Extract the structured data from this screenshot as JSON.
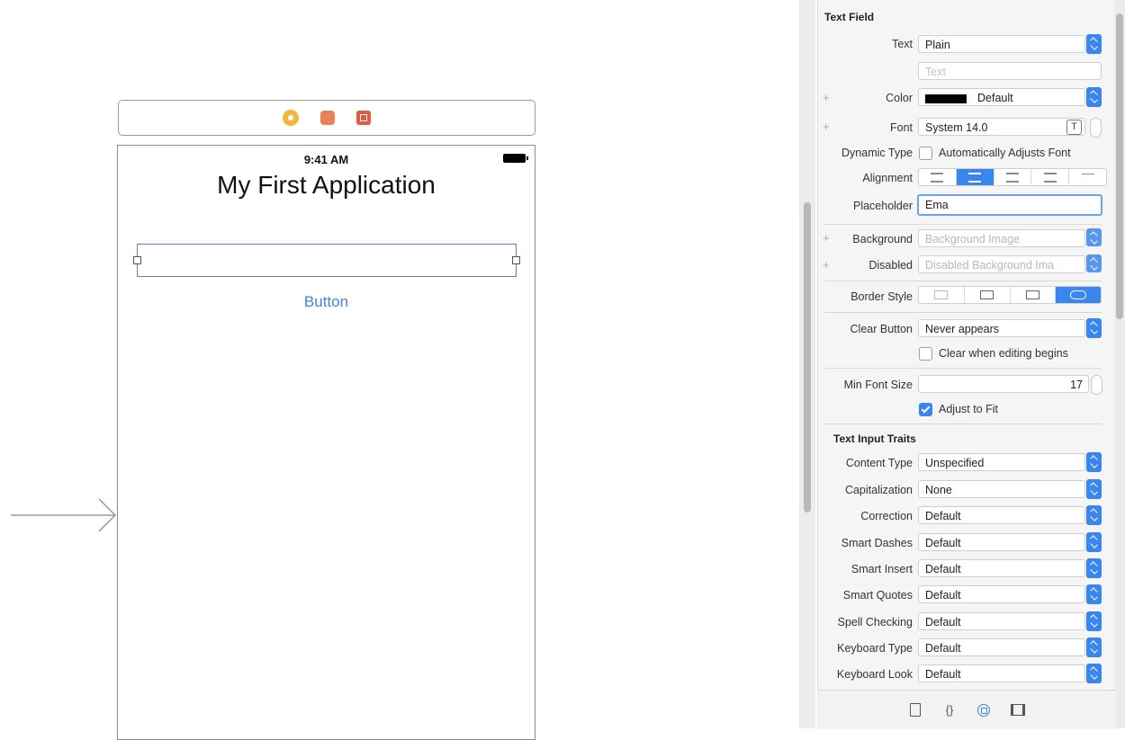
{
  "canvas": {
    "status_time": "9:41 AM",
    "app_title": "My First Application",
    "text_field_value": "",
    "button_label": "Button"
  },
  "inspector": {
    "section_title": "Text Field",
    "text_label": "Text",
    "text_type": "Plain",
    "text_placeholder": "Text",
    "color_label": "Color",
    "color_value": "Default",
    "font_label": "Font",
    "font_value": "System 14.0",
    "font_t_glyph": "T",
    "dynamic_type_label": "Dynamic Type",
    "dynamic_type_checkbox": "Automatically Adjusts Font",
    "alignment_label": "Alignment",
    "placeholder_label": "Placeholder",
    "placeholder_value": "Ema",
    "background_label": "Background",
    "background_value": "Background Image",
    "disabled_label": "Disabled",
    "disabled_value": "Disabled Background Ima",
    "border_style_label": "Border Style",
    "clear_button_label": "Clear Button",
    "clear_button_value": "Never appears",
    "clear_when_editing": "Clear when editing begins",
    "min_font_size_label": "Min Font Size",
    "min_font_size_value": "17",
    "adjust_to_fit": "Adjust to Fit",
    "traits_title": "Text Input Traits",
    "plus_glyph": "+",
    "traits": [
      {
        "label": "Content Type",
        "value": "Unspecified"
      },
      {
        "label": "Capitalization",
        "value": "None"
      },
      {
        "label": "Correction",
        "value": "Default"
      },
      {
        "label": "Smart Dashes",
        "value": "Default"
      },
      {
        "label": "Smart Insert",
        "value": "Default"
      },
      {
        "label": "Smart Quotes",
        "value": "Default"
      },
      {
        "label": "Spell Checking",
        "value": "Default"
      },
      {
        "label": "Keyboard Type",
        "value": "Default"
      },
      {
        "label": "Keyboard Look",
        "value": "Default"
      }
    ],
    "bottom_tabs": {
      "braces": "{}"
    }
  },
  "colors": {
    "accent": "#3a86f0",
    "selection_outline": "#7b6ee6",
    "button_text": "#3f86e6"
  }
}
